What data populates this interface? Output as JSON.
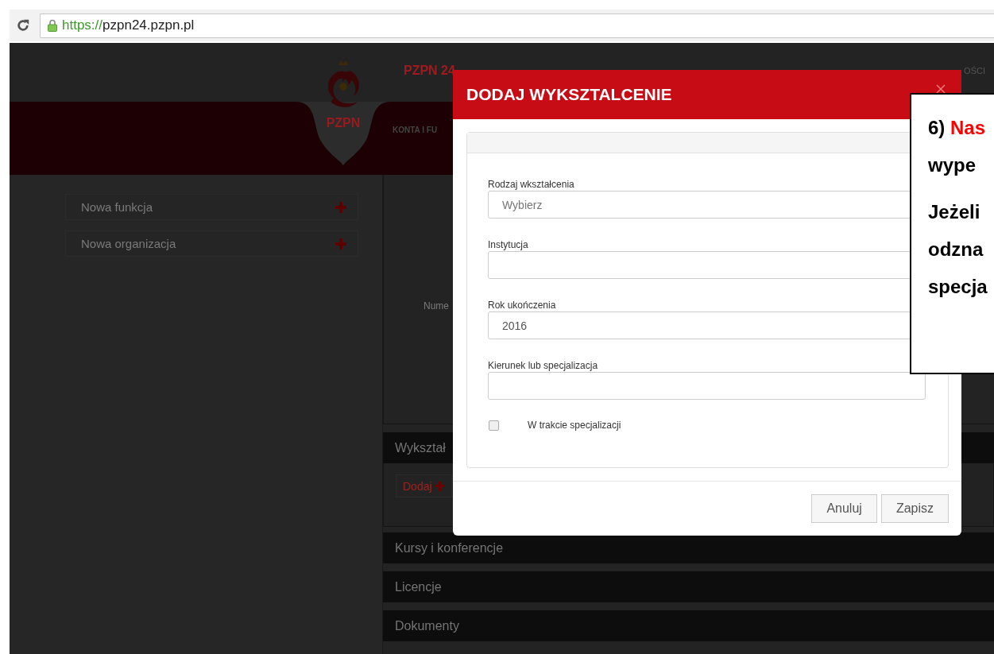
{
  "browser": {
    "url_scheme": "https://",
    "url_host": "pzpn24.pzpn.pl"
  },
  "header": {
    "logo_text": "PZPN",
    "site_title": "PZPN 24",
    "nav": [
      "KONTA I FU"
    ],
    "top_link": "OŚCI"
  },
  "sidebar": {
    "items": [
      {
        "label": "Nowa funkcja"
      },
      {
        "label": "Nowa organizacja"
      }
    ]
  },
  "main": {
    "panel_label": "Nume",
    "sections": [
      {
        "title": "Wykształ",
        "add_button": "Dodaj"
      },
      {
        "title": "Kursy i konferencje"
      },
      {
        "title": "Licencje"
      },
      {
        "title": "Dokumenty"
      }
    ]
  },
  "modal": {
    "title": "DODAJ WYKSZTALCENIE",
    "fields": [
      {
        "label": "Rodzaj wkształcenia",
        "kind": "select",
        "value": "Wybierz"
      },
      {
        "label": "Instytucja",
        "kind": "input"
      },
      {
        "label": "Rok ukończenia",
        "kind": "input",
        "value": "2016"
      },
      {
        "label": "Kierunek lub specjalizacja",
        "kind": "input"
      }
    ],
    "checkbox": {
      "label": "W trakcie specjalizacji",
      "checked": false
    },
    "buttons": [
      "Anuluj",
      "Zapisz"
    ]
  },
  "callout": {
    "paragraphs": [
      [
        {
          "text": "6) ",
          "emphasis": "Nas"
        },
        {
          "text": "wype"
        }
      ],
      [
        {
          "text": "Jeżeli"
        },
        {
          "text": "odzna"
        },
        {
          "text": "specja"
        }
      ]
    ]
  }
}
